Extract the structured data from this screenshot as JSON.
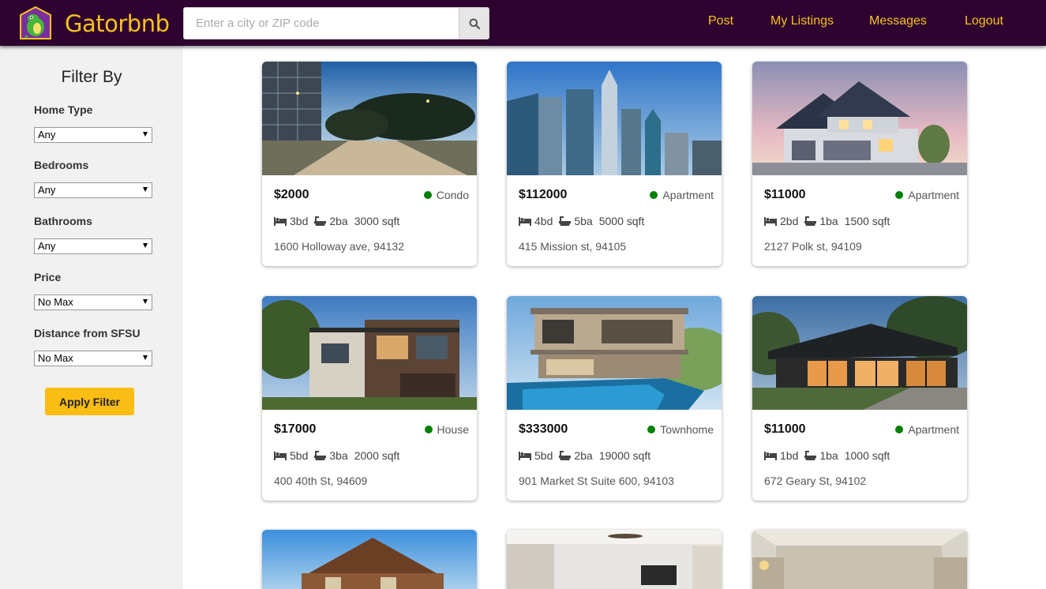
{
  "header": {
    "brand": "Gatorbnb",
    "search_placeholder": "Enter a city or ZIP code",
    "search_icon": "search-icon",
    "nav": [
      "Post",
      "My Listings",
      "Messages",
      "Logout"
    ]
  },
  "sidebar": {
    "title": "Filter By",
    "filters": [
      {
        "label": "Home Type",
        "value": "Any"
      },
      {
        "label": "Bedrooms",
        "value": "Any"
      },
      {
        "label": "Bathrooms",
        "value": "Any"
      },
      {
        "label": "Price",
        "value": "No Max"
      },
      {
        "label": "Distance from SFSU",
        "value": "No Max"
      }
    ],
    "apply_label": "Apply Filter"
  },
  "listings": [
    {
      "price": "$2000",
      "type": "Condo",
      "bd": "3bd",
      "ba": "2ba",
      "sqft": "3000 sqft",
      "address": "1600 Holloway ave, 94132"
    },
    {
      "price": "$112000",
      "type": "Apartment",
      "bd": "4bd",
      "ba": "5ba",
      "sqft": "5000 sqft",
      "address": "415 Mission st, 94105"
    },
    {
      "price": "$11000",
      "type": "Apartment",
      "bd": "2bd",
      "ba": "1ba",
      "sqft": "1500 sqft",
      "address": "2127 Polk st, 94109"
    },
    {
      "price": "$17000",
      "type": "House",
      "bd": "5bd",
      "ba": "3ba",
      "sqft": "2000 sqft",
      "address": "400 40th St, 94609"
    },
    {
      "price": "$333000",
      "type": "Townhome",
      "bd": "5bd",
      "ba": "2ba",
      "sqft": "19000 sqft",
      "address": "901 Market St Suite 600, 94103"
    },
    {
      "price": "$11000",
      "type": "Apartment",
      "bd": "1bd",
      "ba": "1ba",
      "sqft": "1000 sqft",
      "address": "672 Geary St, 94102"
    }
  ],
  "colors": {
    "nav_bg": "#2e0330",
    "brand": "#f7c21d",
    "button": "#f9bd14",
    "status_dot": "#008000"
  }
}
